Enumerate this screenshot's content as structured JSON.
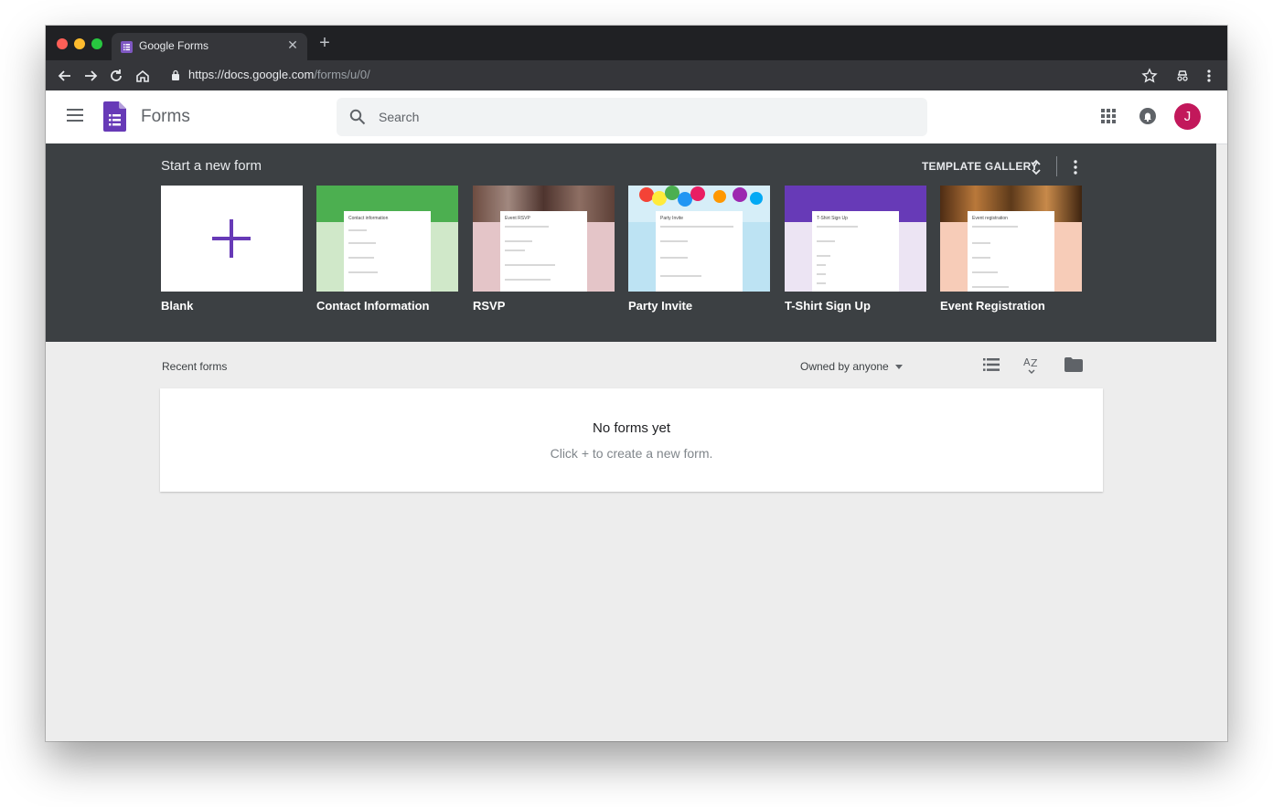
{
  "browser": {
    "tab_title": "Google Forms",
    "url_host": "https://docs.google.com",
    "url_path": "/forms/u/0/",
    "traffic_lights": [
      "#ff5f57",
      "#febc2e",
      "#28c840"
    ]
  },
  "app": {
    "title": "Forms",
    "brand_color": "#673ab7",
    "search_placeholder": "Search",
    "avatar_letter": "J",
    "avatar_color": "#c2185b"
  },
  "templates": {
    "heading": "Start a new form",
    "gallery_label": "TEMPLATE GALLERY",
    "items": [
      {
        "label": "Blank",
        "icon": "plus-icon"
      },
      {
        "label": "Contact Information",
        "preview_title": "Contact information",
        "accent": "#4caf50",
        "bg": "#d0e8c9"
      },
      {
        "label": "RSVP",
        "preview_title": "Event RSVP",
        "accent": "#795548",
        "bg": "#e4c5c8"
      },
      {
        "label": "Party Invite",
        "preview_title": "Party Invite",
        "accent": "#ff7043",
        "bg": "#bde3f3"
      },
      {
        "label": "T-Shirt Sign Up",
        "preview_title": "T-Shirt Sign Up",
        "accent": "#673ab7",
        "bg": "#ece4f3"
      },
      {
        "label": "Event Registration",
        "preview_title": "Event registration",
        "accent": "#8d5a2b",
        "bg": "#f7ccb8"
      }
    ]
  },
  "recent": {
    "title": "Recent forms",
    "owner_filter": "Owned by anyone",
    "empty_title": "No forms yet",
    "empty_subtitle": "Click + to create a new form."
  }
}
